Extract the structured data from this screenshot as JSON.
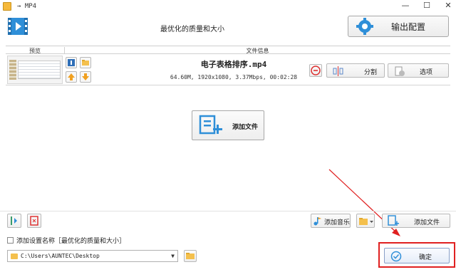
{
  "window": {
    "title": "→ MP4"
  },
  "header": {
    "preset_title": "最优化的质量和大小",
    "output_config_label": "输出配置"
  },
  "table": {
    "columns": [
      "预览",
      "文件信息"
    ],
    "rows": [
      {
        "filename": "电子表格排序.mp4",
        "info": "64.60M, 1920x1080, 3.37Mbps, 00:02:28"
      }
    ]
  },
  "row_actions": {
    "split_label": "分割",
    "options_label": "选项"
  },
  "center": {
    "add_file_label": "添加文件"
  },
  "toolbar": {
    "add_music_label": "添加音乐",
    "add_file_label": "添加文件"
  },
  "bottom": {
    "add_preset_name_label": "添加设置名称［最优化的质量和大小］",
    "output_path": "C:\\Users\\AUNTEC\\Desktop",
    "ok_label": "确定"
  },
  "colors": {
    "accent": "#2f8fd8",
    "highlight": "#e02020",
    "folder": "#f4c04d"
  }
}
